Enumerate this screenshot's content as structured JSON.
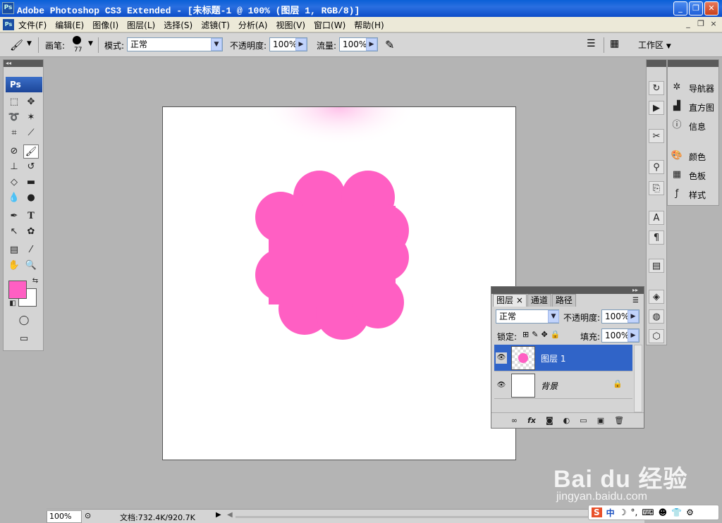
{
  "window": {
    "app_icon": "Ps",
    "title": "Adobe Photoshop CS3 Extended - [未标题-1 @ 100% (图层 1, RGB/8)]",
    "minimize": "_",
    "maximize": "❐",
    "close": "✕"
  },
  "menubar": {
    "items": [
      "文件(F)",
      "编辑(E)",
      "图像(I)",
      "图层(L)",
      "选择(S)",
      "滤镜(T)",
      "分析(A)",
      "视图(V)",
      "窗口(W)",
      "帮助(H)"
    ],
    "doc_minimize": "_",
    "doc_restore": "❐",
    "doc_close": "×"
  },
  "options_bar": {
    "brush_label": "画笔:",
    "brush_size": "77",
    "mode_label": "模式:",
    "mode_value": "正常",
    "opacity_label": "不透明度:",
    "opacity_value": "100%",
    "flow_label": "流量:",
    "flow_value": "100%",
    "workspace_label": "工作区"
  },
  "toolbox": {
    "logo": "Ps",
    "foreground_color": "#ff5fc3",
    "background_color": "#ffffff"
  },
  "canvas": {
    "background": "#ffffff",
    "shape_color": "#ff5fc3",
    "glow_color": "#ffb8e6"
  },
  "dock_panels": {
    "items": [
      {
        "icon": "navigator-icon",
        "label": "导航器"
      },
      {
        "icon": "histogram-icon",
        "label": "直方图"
      },
      {
        "icon": "info-icon",
        "label": "信息"
      },
      {
        "icon": "color-icon",
        "label": "颜色"
      },
      {
        "icon": "swatches-icon",
        "label": "色板"
      },
      {
        "icon": "styles-icon",
        "label": "样式"
      }
    ]
  },
  "layers_panel": {
    "tabs": [
      "图层",
      "通道",
      "路径"
    ],
    "tab_close": "×",
    "blend_mode": "正常",
    "opacity_label": "不透明度:",
    "opacity_value": "100%",
    "lock_label": "锁定:",
    "fill_label": "填充:",
    "fill_value": "100%",
    "layers": [
      {
        "name": "图层 1",
        "selected": true
      },
      {
        "name": "背景",
        "selected": false,
        "locked": true
      }
    ]
  },
  "status_bar": {
    "zoom": "100%",
    "doc_info": "文档:732.4K/920.7K"
  },
  "watermark": {
    "logo": "Bai du 经验",
    "url": "jingyan.baidu.com"
  },
  "ime_bar": {
    "items": [
      "S",
      "中",
      "☽",
      "°,",
      "⌨",
      "☻",
      "👕",
      "⚙"
    ]
  }
}
